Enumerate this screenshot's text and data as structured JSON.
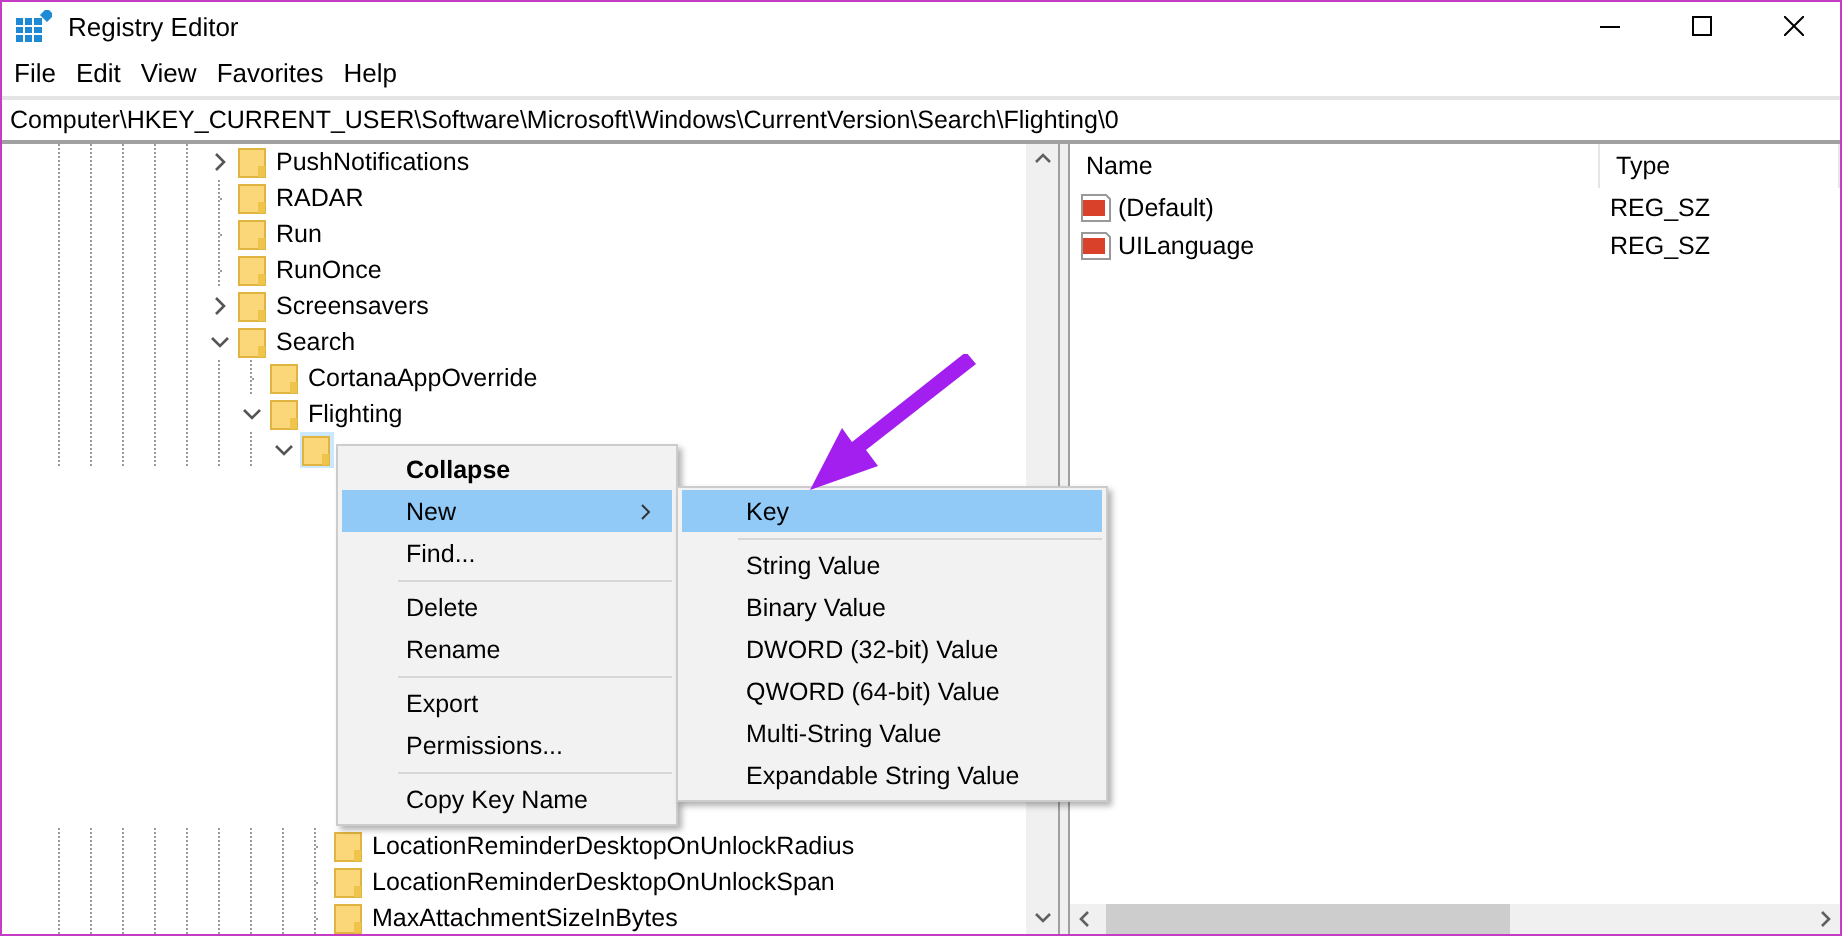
{
  "window": {
    "title": "Registry Editor"
  },
  "menu_bar": [
    "File",
    "Edit",
    "View",
    "Favorites",
    "Help"
  ],
  "address": "Computer\\HKEY_CURRENT_USER\\Software\\Microsoft\\Windows\\CurrentVersion\\Search\\Flighting\\0",
  "tree": [
    {
      "name": "PushNotifications",
      "has_children": true,
      "expanded": false,
      "selected": false
    },
    {
      "name": "RADAR",
      "has_children": false,
      "selected": false
    },
    {
      "name": "Run",
      "has_children": false,
      "selected": false
    },
    {
      "name": "RunOnce",
      "has_children": false,
      "selected": false
    },
    {
      "name": "Screensavers",
      "has_children": true,
      "expanded": false,
      "selected": false
    },
    {
      "name": "Search",
      "has_children": true,
      "expanded": true,
      "selected": false,
      "children": [
        {
          "name": "CortanaAppOverride",
          "has_children": false,
          "selected": false
        },
        {
          "name": "Flighting",
          "has_children": true,
          "expanded": true,
          "selected": false,
          "children": [
            {
              "has_children": true,
              "expanded": true,
              "selected": true,
              "children": [
                {
                  "name": "LocationReminderDesktopOnUnlockRadius",
                  "has_children": false,
                  "selected": false
                },
                {
                  "name": "LocationReminderDesktopOnUnlockSpan",
                  "has_children": false,
                  "selected": false
                },
                {
                  "name": "MaxAttachmentSizeInBytes",
                  "has_children": false,
                  "selected": false
                }
              ]
            }
          ]
        }
      ]
    }
  ],
  "values": {
    "columns": [
      "Name",
      "Type"
    ],
    "rows": [
      {
        "name": "(Default)",
        "type": "REG_SZ"
      },
      {
        "name": "UILanguage",
        "type": "REG_SZ"
      }
    ]
  },
  "context_menu": {
    "items": [
      {
        "kind": "item",
        "label": "Collapse",
        "bold": true,
        "submenu": false,
        "selected": false
      },
      {
        "kind": "item",
        "label": "New",
        "bold": false,
        "submenu": true,
        "selected": true
      },
      {
        "kind": "item",
        "label": "Find...",
        "bold": false,
        "submenu": false,
        "selected": false
      },
      {
        "kind": "separator"
      },
      {
        "kind": "item",
        "label": "Delete",
        "bold": false,
        "submenu": false,
        "selected": false
      },
      {
        "kind": "item",
        "label": "Rename",
        "bold": false,
        "submenu": false,
        "selected": false
      },
      {
        "kind": "separator"
      },
      {
        "kind": "item",
        "label": "Export",
        "bold": false,
        "submenu": false,
        "selected": false
      },
      {
        "kind": "item",
        "label": "Permissions...",
        "bold": false,
        "submenu": false,
        "selected": false
      },
      {
        "kind": "separator"
      },
      {
        "kind": "item",
        "label": "Copy Key Name",
        "bold": false,
        "submenu": false,
        "selected": false
      }
    ]
  },
  "submenu": {
    "items": [
      {
        "kind": "item",
        "label": "Key",
        "selected": true
      },
      {
        "kind": "separator"
      },
      {
        "kind": "item",
        "label": "String Value",
        "selected": false
      },
      {
        "kind": "item",
        "label": "Binary Value",
        "selected": false
      },
      {
        "kind": "item",
        "label": "DWORD (32-bit) Value",
        "selected": false
      },
      {
        "kind": "item",
        "label": "QWORD (64-bit) Value",
        "selected": false
      },
      {
        "kind": "item",
        "label": "Multi-String Value",
        "selected": false
      },
      {
        "kind": "item",
        "label": "Expandable String Value",
        "selected": false
      }
    ]
  }
}
